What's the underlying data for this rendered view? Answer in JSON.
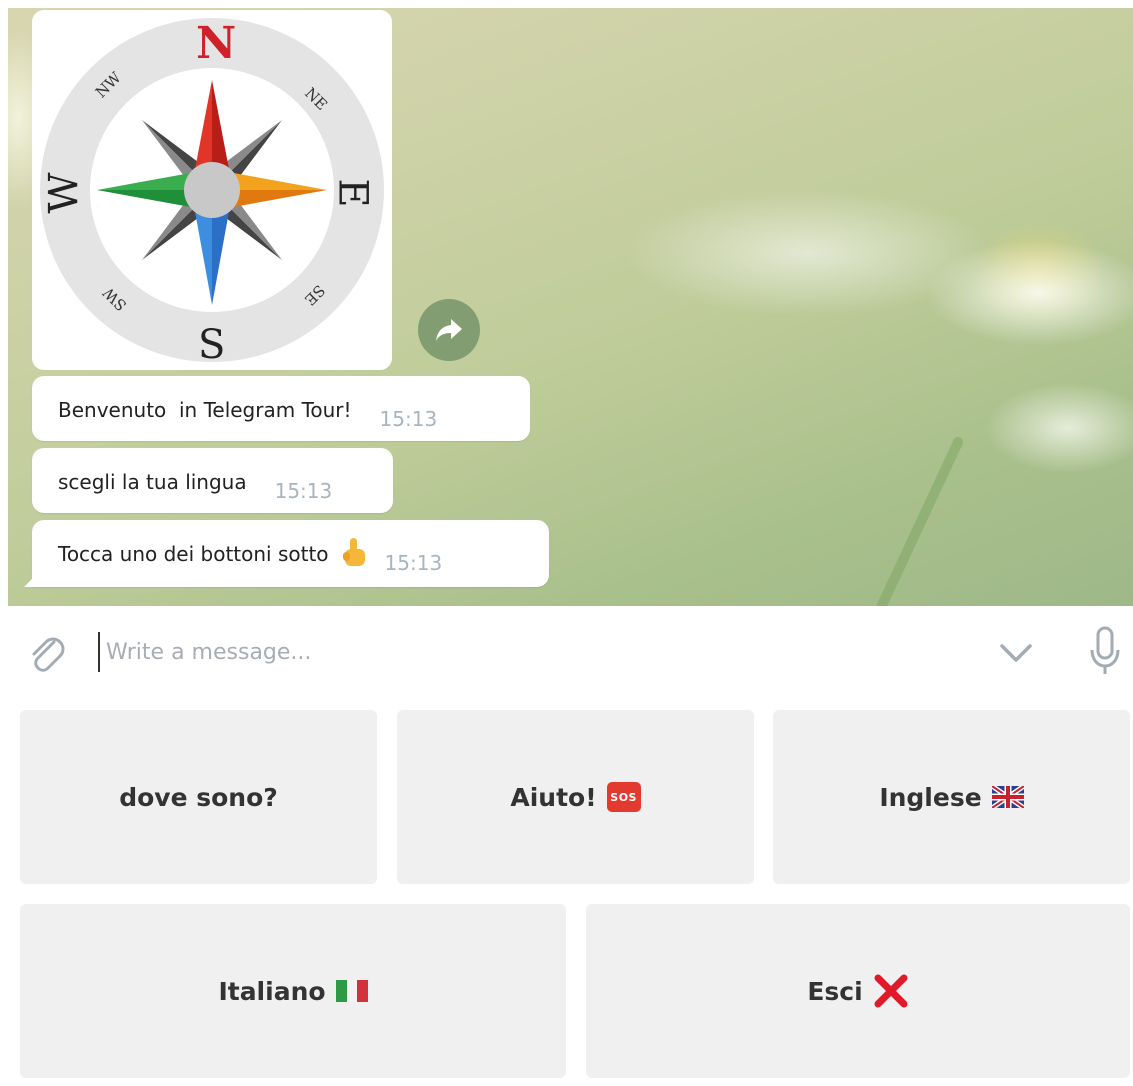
{
  "chat": {
    "messages": [
      {
        "text": "Benvenuto  in Telegram Tour!",
        "time": "15:13"
      },
      {
        "text": "scegli la tua lingua",
        "time": "15:13"
      },
      {
        "text": "Tocca uno dei bottoni sotto",
        "time": "15:13",
        "emoji_icon": "pointing-hand-icon"
      }
    ],
    "sticker": {
      "icon": "compass-rose-icon",
      "labels": {
        "n": "N",
        "e": "E",
        "s": "S",
        "w": "W",
        "ne": "NE",
        "nw": "NW",
        "se": "SE",
        "sw": "SW"
      }
    },
    "share_icon": "share-arrow-icon"
  },
  "composer": {
    "placeholder": "Write a message...",
    "value": "",
    "attach_icon": "paperclip-icon",
    "expand_icon": "chevron-down-icon",
    "mic_icon": "microphone-icon"
  },
  "keyboard": {
    "rows": [
      [
        {
          "label": "dove sono?"
        },
        {
          "label": "Aiuto!",
          "icon": "sos-icon",
          "icon_text": "SOS"
        },
        {
          "label": "Inglese",
          "icon": "uk-flag-icon"
        }
      ],
      [
        {
          "label": "Italiano",
          "icon": "italy-flag-icon"
        },
        {
          "label": "Esci",
          "icon": "red-x-icon"
        }
      ]
    ]
  },
  "colors": {
    "bubble": "#ffffff",
    "time_text": "#a8b4be",
    "button_bg": "#f0f0f0",
    "north_red": "#d0202a"
  }
}
